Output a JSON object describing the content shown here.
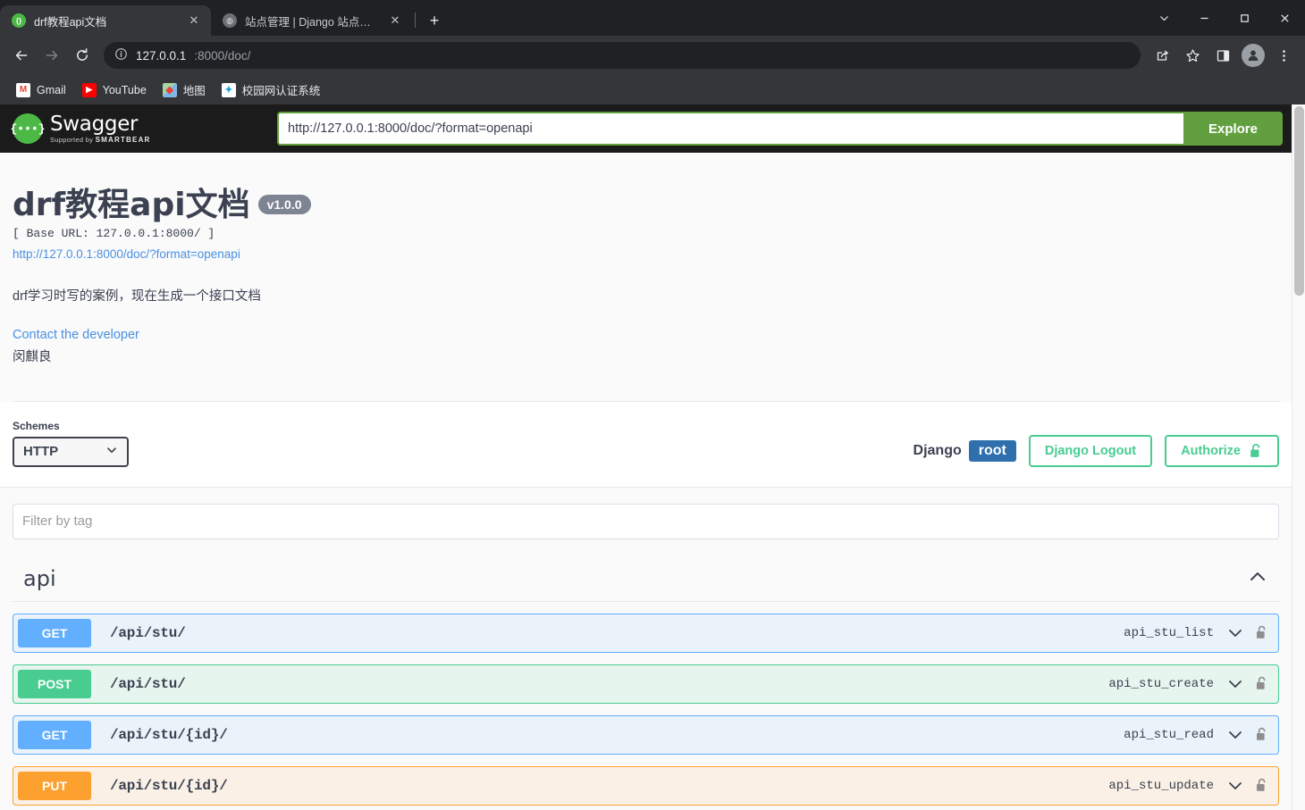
{
  "browser": {
    "tabs": [
      {
        "title": "drf教程api文档",
        "favicon": "swagger-favicon",
        "active": true,
        "close_label": "✕"
      },
      {
        "title": "站点管理 | Django 站点管理员",
        "favicon": "django-favicon",
        "active": false,
        "close_label": "✕"
      }
    ],
    "new_tab_label": "+",
    "window_controls": [
      "chevron-down-icon",
      "minimize-icon",
      "maximize-icon",
      "close-icon"
    ],
    "nav": {
      "back_label": "←",
      "forward_label": "→",
      "reload_label": "⟳",
      "info_label": "ⓘ"
    },
    "omnibox": {
      "host": "127.0.0.1",
      "rest": ":8000/doc/",
      "full": "127.0.0.1:8000/doc/"
    },
    "toolbar_icons": [
      "share-icon",
      "bookmark-star-icon",
      "side-panel-icon",
      "profile-avatar-icon",
      "more-menu-icon"
    ],
    "bookmarks": [
      {
        "label": "Gmail",
        "icon": "gmail-icon",
        "glyph": "M"
      },
      {
        "label": "YouTube",
        "icon": "youtube-icon",
        "glyph": "▶"
      },
      {
        "label": "地图",
        "icon": "maps-icon",
        "glyph": "📍"
      },
      {
        "label": "校园网认证系统",
        "icon": "campus-net-icon",
        "glyph": "✦"
      }
    ]
  },
  "swagger": {
    "logo": {
      "mark": "{•••}",
      "name": "Swagger",
      "supported_by_prefix": "Supported by",
      "supported_by_brand": "SMARTBEAR"
    },
    "explore": {
      "url_value": "http://127.0.0.1:8000/doc/?format=openapi",
      "url_placeholder": "",
      "button_label": "Explore"
    },
    "info": {
      "title": "drf教程api文档",
      "version": "v1.0.0",
      "base_url": "[ Base URL: 127.0.0.1:8000/ ]",
      "spec_link": "http://127.0.0.1:8000/doc/?format=openapi",
      "description": "drf学习时写的案例，现在生成一个接口文档",
      "contact_label": "Contact the developer",
      "contact_name": "闵麒良"
    },
    "schemes": {
      "label": "Schemes",
      "selected": "HTTP",
      "options": [
        "HTTP"
      ],
      "chevron": "chevron-down-icon"
    },
    "auth": {
      "django_label": "Django",
      "username_badge": "root",
      "logout_label": "Django Logout",
      "authorize_label": "Authorize",
      "authorize_icon": "unlocked-padlock-icon"
    },
    "filter": {
      "placeholder": "Filter by tag",
      "value": ""
    },
    "tags": [
      {
        "name": "api",
        "expanded": true,
        "toggle_icon": "chevron-up-icon",
        "operations": [
          {
            "method": "GET",
            "path": "/api/stu/",
            "operation_id": "api_stu_list",
            "chevron": "chevron-down-icon",
            "lock": "unlocked-padlock-icon"
          },
          {
            "method": "POST",
            "path": "/api/stu/",
            "operation_id": "api_stu_create",
            "chevron": "chevron-down-icon",
            "lock": "unlocked-padlock-icon"
          },
          {
            "method": "GET",
            "path": "/api/stu/{id}/",
            "operation_id": "api_stu_read",
            "chevron": "chevron-down-icon",
            "lock": "unlocked-padlock-icon"
          },
          {
            "method": "PUT",
            "path": "/api/stu/{id}/",
            "operation_id": "api_stu_update",
            "chevron": "chevron-down-icon",
            "lock": "unlocked-padlock-icon"
          }
        ]
      }
    ]
  },
  "colors": {
    "brand_green": "#62a03f",
    "get_blue": "#61affe",
    "post_green": "#49cc90",
    "put_orange": "#fca130",
    "django_blue": "#2f6fad",
    "authorize_green": "#49cc90",
    "link_blue": "#4990e2",
    "text_dark": "#3b4151"
  }
}
